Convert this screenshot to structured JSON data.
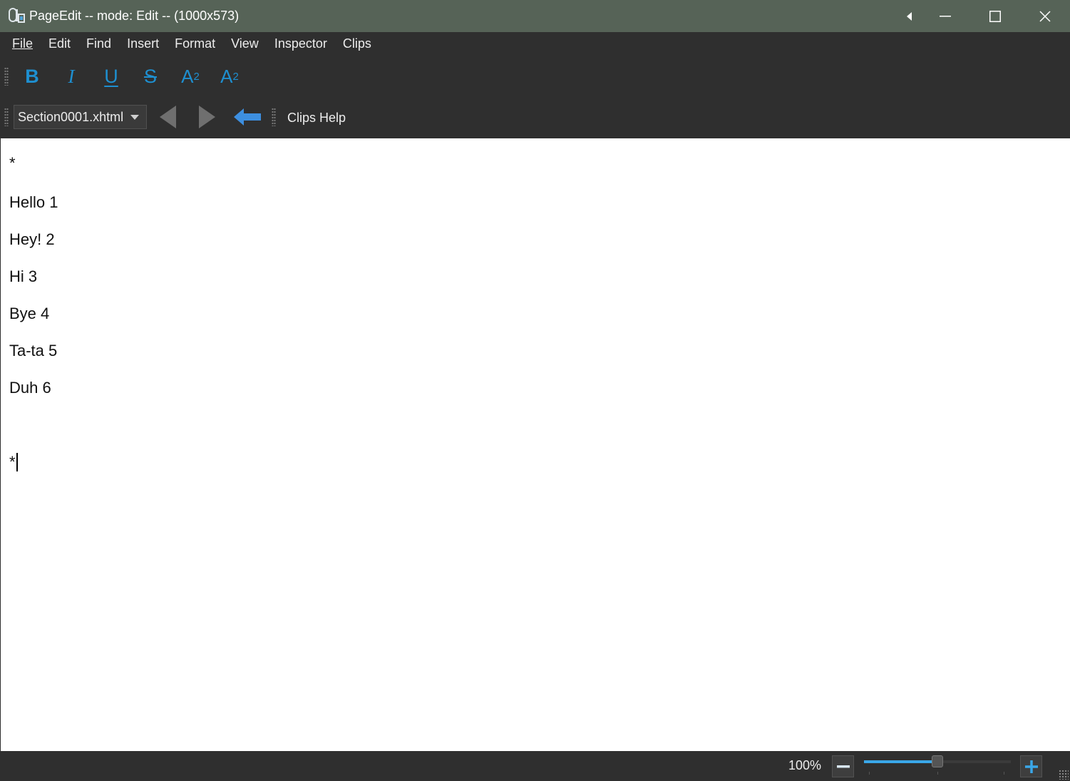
{
  "window": {
    "title": "PageEdit -- mode: Edit -- (1000x573)",
    "icon": "pageedit-app-icon",
    "controls": [
      "back-arrow-icon",
      "minimize-icon",
      "maximize-icon",
      "close-icon"
    ]
  },
  "menu": {
    "items": [
      {
        "label": "File",
        "accel": "F"
      },
      {
        "label": "Edit",
        "accel": "E"
      },
      {
        "label": "Find",
        "accel": "F"
      },
      {
        "label": "Insert",
        "accel": "I"
      },
      {
        "label": "Format",
        "accel": "m"
      },
      {
        "label": "View",
        "accel": "V"
      },
      {
        "label": "Inspector",
        "accel": ""
      },
      {
        "label": "Clips",
        "accel": ""
      }
    ]
  },
  "format_toolbar": {
    "bold": "B",
    "italic": "I",
    "underline": "U",
    "strikethrough": "S",
    "subscript_base": "A",
    "subscript_index": "2",
    "superscript_base": "A",
    "superscript_index": "2",
    "accent_color": "#1e8fd0"
  },
  "nav_toolbar": {
    "file_select": "Section0001.xhtml",
    "prev_icon": "triangle-left-icon",
    "next_icon": "triangle-right-icon",
    "back_icon": "arrow-left-icon",
    "clips_help": "Clips Help"
  },
  "editor": {
    "lines": [
      "*",
      "Hello 1",
      "Hey! 2",
      "Hi 3",
      "Bye 4",
      "Ta-ta 5",
      "Duh 6",
      "*"
    ]
  },
  "status": {
    "zoom_label": "100%",
    "zoom_level": 0.5,
    "zoom_out_icon": "minus-icon",
    "zoom_in_icon": "plus-icon"
  }
}
